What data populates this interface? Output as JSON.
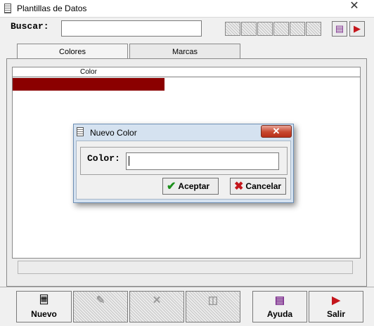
{
  "window": {
    "title": "Plantillas de Datos",
    "close": "✕"
  },
  "search": {
    "label": "Buscar:",
    "value": ""
  },
  "toolbar": {
    "book_icon": "book-icon",
    "exit_icon": "exit-door-icon"
  },
  "tabs": [
    {
      "label": "Colores",
      "active": true
    },
    {
      "label": "Marcas",
      "active": false
    }
  ],
  "grid": {
    "columns": [
      "Color"
    ],
    "selected_row_color": "#8b0000"
  },
  "dialog": {
    "title": "Nuevo Color",
    "close": "✕",
    "field_label": "Color:",
    "field_value": "",
    "accept_label": "Aceptar",
    "cancel_label": "Cancelar"
  },
  "bottom_buttons": [
    {
      "label": "Nuevo",
      "icon": "new-document-icon",
      "enabled": true
    },
    {
      "label": "",
      "icon": "edit-icon",
      "enabled": false
    },
    {
      "label": "",
      "icon": "delete-icon",
      "enabled": false
    },
    {
      "label": "",
      "icon": "save-icon",
      "enabled": false
    },
    {
      "label": "Ayuda",
      "icon": "book-icon",
      "enabled": true
    },
    {
      "label": "Salir",
      "icon": "exit-door-icon",
      "enabled": true
    }
  ],
  "colors": {
    "accent_row": "#8b0000",
    "dialog_frame": "#d5e2f0",
    "close_red": "#c7472f"
  }
}
